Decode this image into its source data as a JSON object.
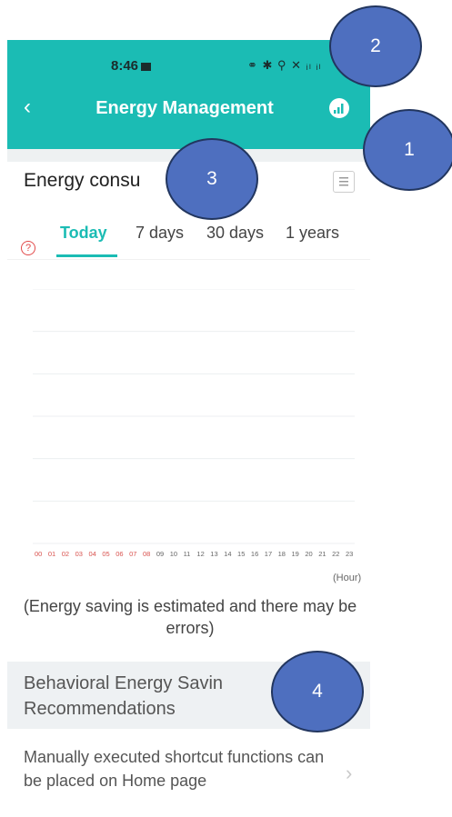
{
  "status_bar": {
    "time": "8:46",
    "icons": "⚭ ✱ ⚲ ✕ ᵢₗ ᵢₗ"
  },
  "header": {
    "back_label": "‹",
    "title": "Energy Management"
  },
  "section": {
    "title": "Energy consu"
  },
  "tabs": [
    {
      "label": "Today",
      "active": true
    },
    {
      "label": "7 days",
      "active": false
    },
    {
      "label": "30 days",
      "active": false
    },
    {
      "label": "1 years",
      "active": false
    }
  ],
  "help_icon": "?",
  "chart_data": {
    "type": "line",
    "x": [
      "00",
      "01",
      "02",
      "03",
      "04",
      "05",
      "06",
      "07",
      "08",
      "09",
      "10",
      "11",
      "12",
      "13",
      "14",
      "15",
      "16",
      "17",
      "18",
      "19",
      "20",
      "21",
      "22",
      "23"
    ],
    "highlight_labels": [
      "00",
      "01",
      "02",
      "03",
      "04",
      "05",
      "06",
      "07",
      "08"
    ],
    "xlabel": "(Hour)",
    "gridlines": 6,
    "series": []
  },
  "note": "(Energy saving is estimated and there may be errors)",
  "recommendations": {
    "title": "Behavioral Energy Savin Recommendations",
    "items": [
      {
        "label": "Manually executed shortcut functions can be placed on Home page"
      }
    ],
    "chevron": "›"
  },
  "callouts": [
    {
      "label": "1"
    },
    {
      "label": "2"
    },
    {
      "label": "3"
    },
    {
      "label": "4"
    }
  ],
  "colors": {
    "accent": "#1bbcb4",
    "callout": "#4e6fbf",
    "highlight_tick": "#d9534f"
  }
}
